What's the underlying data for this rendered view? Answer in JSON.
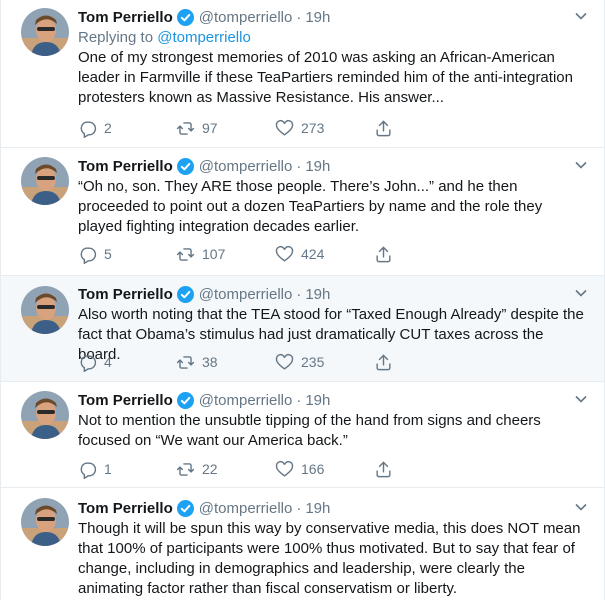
{
  "author": {
    "name": "Tom Perriello",
    "handle": "@tomperriello",
    "separator": "·",
    "time": "19h"
  },
  "replying": {
    "prefix": "Replying to",
    "handle": "@tomperriello"
  },
  "tweets": [
    {
      "text": "One of my strongest memories of 2010 was asking an African-American leader in Farmville if these TeaPartiers reminded him of the anti-integration protesters known as Massive Resistance. His answer...",
      "replies": "2",
      "retweets": "97",
      "likes": "273"
    },
    {
      "text": "“Oh no, son. They ARE those people. There’s John...” and he then proceeded to point out a dozen TeaPartiers by name and the role they played fighting integration decades earlier.",
      "replies": "5",
      "retweets": "107",
      "likes": "424"
    },
    {
      "text": "Also worth noting that the TEA stood for “Taxed Enough Already” despite the fact that Obama’s stimulus had just dramatically CUT taxes across the board.",
      "replies": "4",
      "retweets": "38",
      "likes": "235"
    },
    {
      "text": "Not to mention the unsubtle tipping of the hand from signs and cheers focused on “We want our America back.”",
      "replies": "1",
      "retweets": "22",
      "likes": "166"
    },
    {
      "text": "Though it will be spun this way by conservative media, this does NOT mean that 100% of participants were 100% thus motivated. But to say that fear of change, including in demographics and leadership, were clearly the animating factor rather than fiscal conservatism or liberty."
    }
  ],
  "icons": {
    "reply": "reply-icon",
    "retweet": "retweet-icon",
    "like": "heart-icon",
    "share": "share-icon",
    "verified": "verified-badge-icon",
    "more": "chevron-down-icon"
  },
  "colors": {
    "link": "#1b95e0",
    "muted": "#657786",
    "verified": "#1da1f2",
    "shaded_bg": "#f5f8fa"
  }
}
